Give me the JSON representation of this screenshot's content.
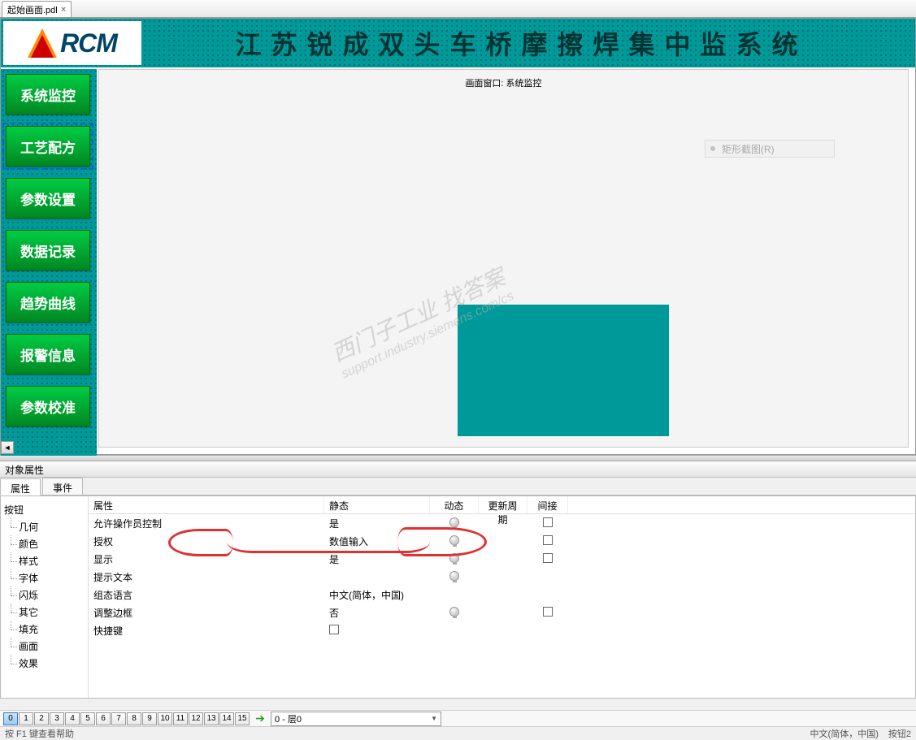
{
  "tab": {
    "filename": "起始画面.pdl",
    "close": "×"
  },
  "header": {
    "logo_text": "RCM",
    "title": "江苏锐成双头车桥摩擦焊集中监系统"
  },
  "nav": {
    "items": [
      {
        "label": "系统监控"
      },
      {
        "label": "工艺配方"
      },
      {
        "label": "参数设置"
      },
      {
        "label": "数据记录"
      },
      {
        "label": "趋势曲线"
      },
      {
        "label": "报警信息"
      },
      {
        "label": "参数校准"
      }
    ]
  },
  "canvas": {
    "overlay_title": "画面窗口: 系统监控",
    "ghost_menu": "矩形截图(R)"
  },
  "watermark": {
    "line1": "西门子工业 找答案",
    "line2": "support.industry.siemens.com/cs"
  },
  "props_panel": {
    "title": "对象属性",
    "tabs": {
      "properties": "属性",
      "events": "事件"
    },
    "tree_root": "按钮",
    "tree": [
      "几何",
      "颜色",
      "样式",
      "字体",
      "闪烁",
      "其它",
      "填充",
      "画面",
      "效果"
    ],
    "headers": {
      "prop": "属性",
      "static": "静态",
      "dynamic": "动态",
      "update": "更新周期",
      "indirect": "间接"
    },
    "rows": [
      {
        "prop": "允许操作员控制",
        "static": "是",
        "bulb": true,
        "chk": true
      },
      {
        "prop": "授权",
        "static": "数值输入",
        "bulb": true,
        "chk": true
      },
      {
        "prop": "显示",
        "static": "是",
        "bulb": true,
        "chk": true
      },
      {
        "prop": "提示文本",
        "static": "",
        "bulb": true,
        "chk": false
      },
      {
        "prop": "组态语言",
        "static": "中文(简体，中国)",
        "bulb": false,
        "chk": false
      },
      {
        "prop": "调整边框",
        "static": "否",
        "bulb": true,
        "chk": true
      },
      {
        "prop": "快捷键",
        "static_checkbox": true,
        "bulb": false,
        "chk": false
      }
    ]
  },
  "layers": {
    "buttons": [
      "0",
      "1",
      "2",
      "3",
      "4",
      "5",
      "6",
      "7",
      "8",
      "9",
      "10",
      "11",
      "12",
      "13",
      "14",
      "15"
    ],
    "combo": "0 - 层0"
  },
  "status": {
    "left": "按 F1 键查看帮助",
    "lang": "中文(简体，中国)",
    "obj": "按钮2"
  }
}
